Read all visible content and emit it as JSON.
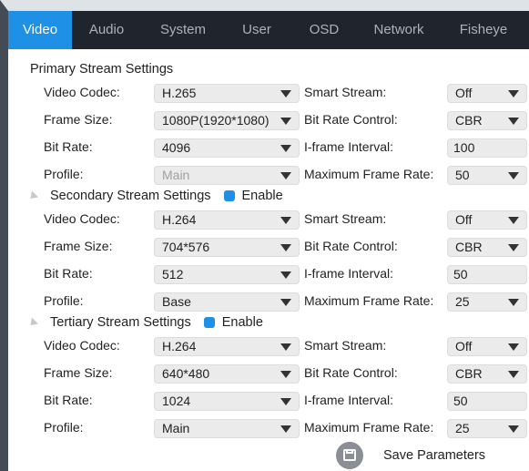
{
  "tabs": [
    "Video",
    "Audio",
    "System",
    "User",
    "OSD",
    "Network",
    "Fisheye"
  ],
  "active_tab": "Video",
  "labels": {
    "video_codec": "Video Codec:",
    "frame_size": "Frame Size:",
    "bit_rate": "Bit Rate:",
    "profile": "Profile:",
    "smart_stream": "Smart Stream:",
    "bit_rate_control": "Bit Rate Control:",
    "iframe_interval": "I-frame Interval:",
    "max_frame_rate": "Maximum Frame Rate:"
  },
  "primary": {
    "title": "Primary Stream Settings",
    "video_codec": "H.265",
    "frame_size": "1080P(1920*1080)",
    "bit_rate": "4096",
    "profile": "Main",
    "smart_stream": "Off",
    "bit_rate_control": "CBR",
    "iframe_interval": "100",
    "max_frame_rate": "50"
  },
  "secondary": {
    "title": "Secondary Stream Settings",
    "enable_label": "Enable",
    "enabled": true,
    "video_codec": "H.264",
    "frame_size": "704*576",
    "bit_rate": "512",
    "profile": "Base",
    "smart_stream": "Off",
    "bit_rate_control": "CBR",
    "iframe_interval": "50",
    "max_frame_rate": "25"
  },
  "tertiary": {
    "title": "Tertiary Stream Settings",
    "enable_label": "Enable",
    "enabled": true,
    "video_codec": "H.264",
    "frame_size": "640*480",
    "bit_rate": "1024",
    "profile": "Main",
    "smart_stream": "Off",
    "bit_rate_control": "CBR",
    "iframe_interval": "50",
    "max_frame_rate": "25"
  },
  "save_label": "Save Parameters",
  "colors": {
    "tab_bar": "#20252d",
    "active_tab": "#1e90e6",
    "checkbox": "#1e90e6"
  }
}
